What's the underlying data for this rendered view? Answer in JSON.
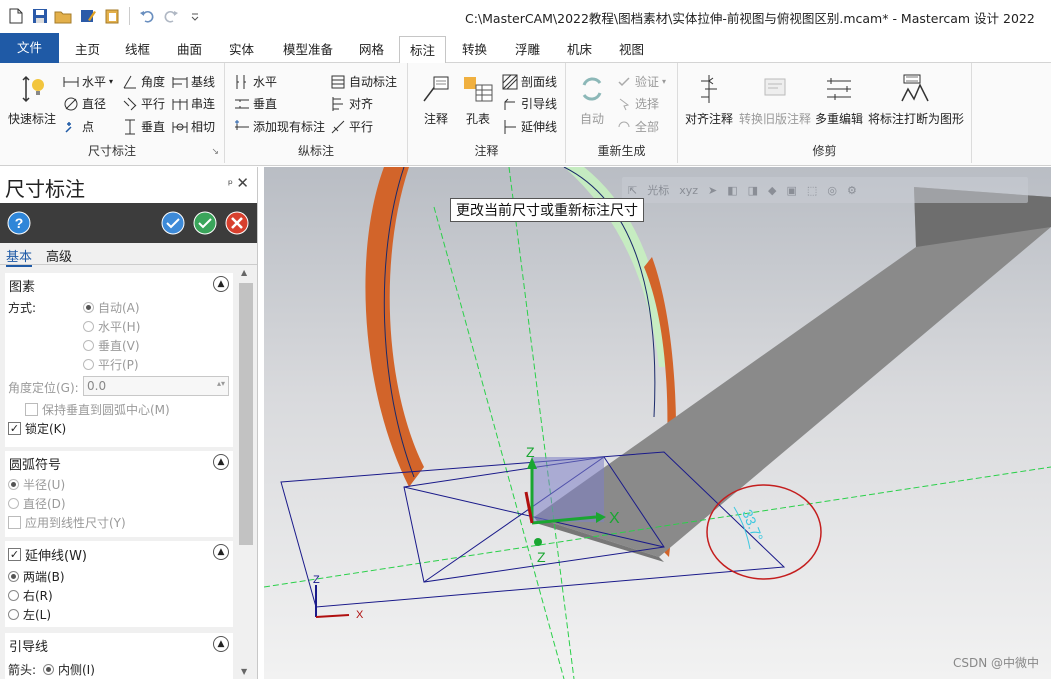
{
  "window": {
    "title": "C:\\MasterCAM\\2022教程\\图档素材\\实体拉伸-前视图与俯视图区别.mcam* - Mastercam 设计 2022"
  },
  "ribbon_tabs": [
    "文件",
    "主页",
    "线框",
    "曲面",
    "实体",
    "模型准备",
    "网格",
    "标注",
    "转换",
    "浮雕",
    "机床",
    "视图"
  ],
  "active_tab": "标注",
  "ribbon": {
    "dimension": {
      "label": "尺寸标注",
      "quick": "快速标注",
      "horizontal": "水平",
      "angle": "角度",
      "baseline": "基线",
      "diameter": "直径",
      "parallel": "平行",
      "chain": "串连",
      "point": "点",
      "vertical": "垂直",
      "tangent": "相切"
    },
    "ordinate": {
      "label": "纵标注",
      "horizontal": "水平",
      "auto": "自动标注",
      "vertical": "垂直",
      "align": "对齐",
      "add_existing": "添加现有标注",
      "parallel": "平行"
    },
    "annotation": {
      "label": "注释",
      "note": "注释",
      "hole_table": "孔表",
      "hatch": "剖面线",
      "leader": "引导线",
      "extension": "延伸线"
    },
    "regen": {
      "label": "重新生成",
      "auto": "自动",
      "validate": "验证",
      "select": "选择",
      "all": "全部"
    },
    "trim": {
      "label": "修剪",
      "align_note": "对齐注释",
      "convert_old": "转换旧版注释",
      "multi_edit": "多重编辑",
      "break_to_geom": "将标注打断为图形"
    }
  },
  "panel": {
    "title": "尺寸标注",
    "pin": "ᵖ",
    "close": "✕",
    "tabs": [
      "基本",
      "高级"
    ],
    "sections": {
      "geometry": {
        "title": "图素",
        "method_label": "方式:",
        "methods": [
          "自动(A)",
          "水平(H)",
          "垂直(V)",
          "平行(P)"
        ],
        "angle_label": "角度定位(G):",
        "angle_value": "0.0",
        "keep_perp": "保持垂直到圆弧中心(M)",
        "lock": "锁定(K)"
      },
      "arc": {
        "title": "圆弧符号",
        "radius": "半径(U)",
        "diameter": "直径(D)",
        "apply_linear": "应用到线性尺寸(Y)"
      },
      "ext": {
        "title": "延伸线(W)",
        "both": "两端(B)",
        "right": "右(R)",
        "left": "左(L)"
      },
      "leader": {
        "title": "引导线",
        "arrow_label": "箭头:",
        "arrow_value": "内侧(I)"
      }
    }
  },
  "viewport": {
    "tooltip": "更改当前尺寸或重新标注尺寸",
    "toolbar_label": "光标",
    "axis_x": "X",
    "axis_z": "Z",
    "dim_value": "33.7°",
    "watermark": "CSDN @中微中"
  }
}
